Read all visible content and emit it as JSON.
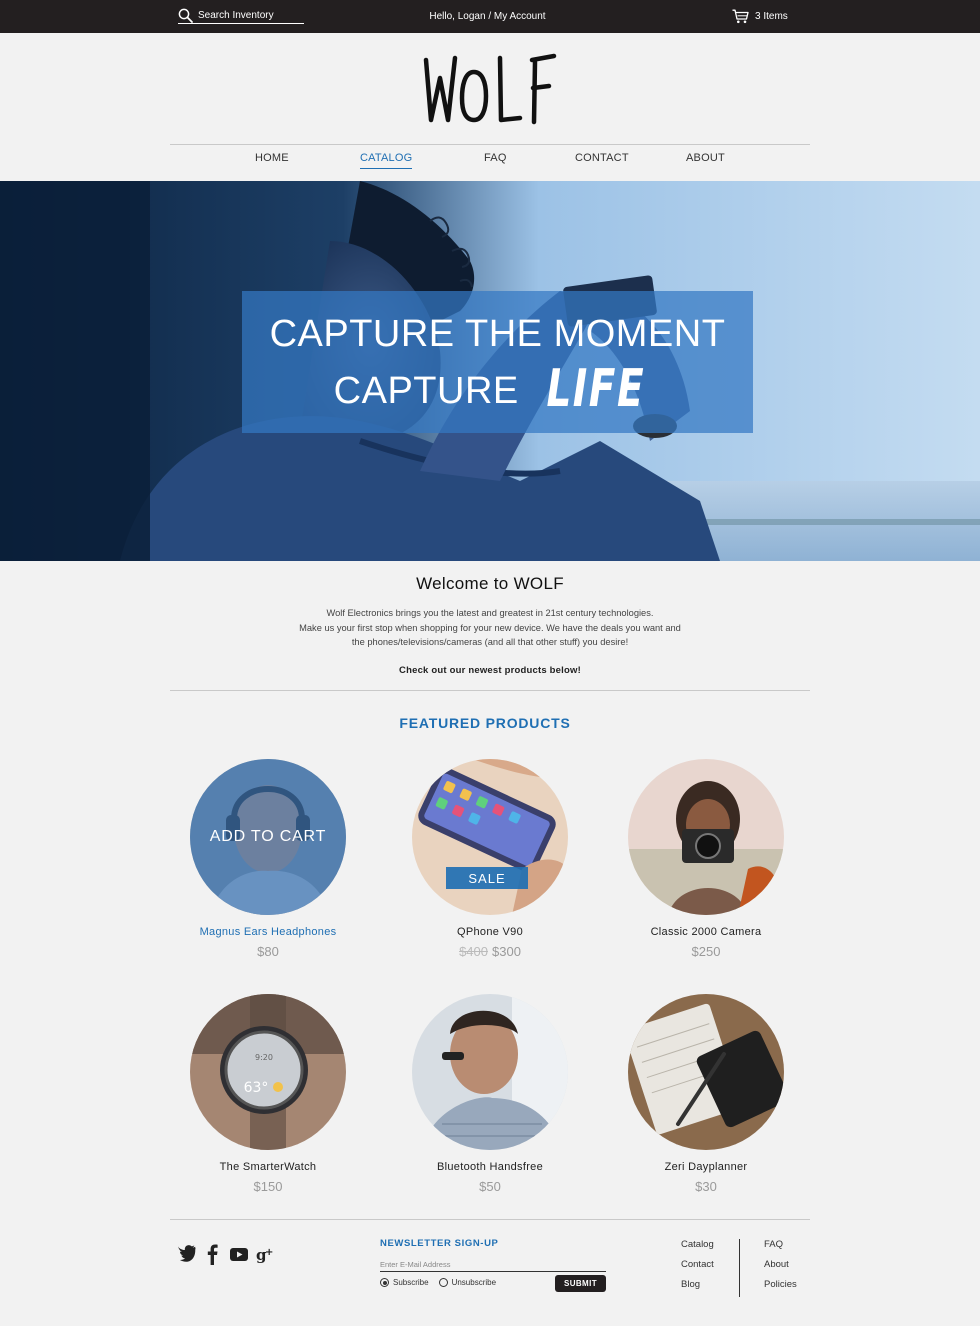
{
  "topbar": {
    "search_placeholder": "Search Inventory",
    "greeting": "Hello, Logan",
    "separator": " / ",
    "account_link": "My Account",
    "cart_count": "3 Items"
  },
  "brand": {
    "logo_text": "WOLF"
  },
  "nav": [
    {
      "label": "HOME",
      "active": false
    },
    {
      "label": "CATALOG",
      "active": true
    },
    {
      "label": "FAQ",
      "active": false
    },
    {
      "label": "CONTACT",
      "active": false
    },
    {
      "label": "ABOUT",
      "active": false
    }
  ],
  "hero": {
    "line1": "CAPTURE THE MOMENT",
    "line2_prefix": "CAPTURE",
    "line2_accent": "LIFE"
  },
  "welcome": {
    "title": "Welcome to WOLF",
    "line1": "Wolf Electronics brings you the latest and greatest in 21st century technologies.",
    "line2": "Make us your first stop when shopping for your new device. We have the deals you want and",
    "line3": "the phones/televisions/cameras (and all that other stuff) you desire!",
    "cta": "Check out our newest products below!"
  },
  "featured": {
    "title": "FEATURED PRODUCTS",
    "add_to_cart": "ADD TO CART",
    "sale_label": "SALE",
    "products": [
      {
        "name": "Magnus Ears Headphones",
        "price": "$80"
      },
      {
        "name": "QPhone V90",
        "old_price": "$400",
        "price": "$300"
      },
      {
        "name": "Classic 2000 Camera",
        "price": "$250"
      },
      {
        "name": "The SmarterWatch",
        "price": "$150",
        "watch_time": "9:20",
        "watch_temp": "63°"
      },
      {
        "name": "Bluetooth Handsfree",
        "price": "$50"
      },
      {
        "name": "Zeri Dayplanner",
        "price": "$30"
      }
    ]
  },
  "footer": {
    "social_icons": [
      "twitter-icon",
      "facebook-icon",
      "youtube-icon",
      "google-plus-icon"
    ],
    "newsletter_title": "NEWSLETTER SIGN-UP",
    "email_placeholder": "Enter E-Mail Address",
    "subscribe_label": "Subscribe",
    "unsubscribe_label": "Unsubscribe",
    "submit_label": "SUBMIT",
    "links_col1": [
      "Catalog",
      "Contact",
      "Blog"
    ],
    "links_col2": [
      "FAQ",
      "About",
      "Policies"
    ]
  },
  "colors": {
    "accent": "#1f6fb3",
    "topbar": "#231f20",
    "background": "#f2f2f2"
  }
}
